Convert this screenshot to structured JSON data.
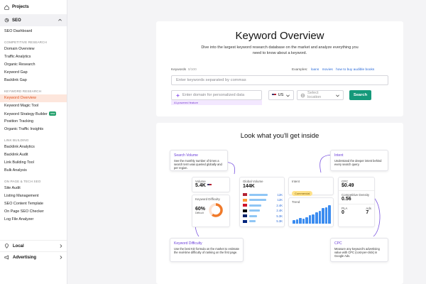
{
  "sidebar": {
    "projects": "Projects",
    "seo": "SEO",
    "seo_dashboard": "SEO Dashboard",
    "sections": [
      {
        "title": "COMPETITIVE RESEARCH",
        "items": [
          "Domain Overview",
          "Traffic Analytics",
          "Organic Research",
          "Keyword Gap",
          "Backlink Gap"
        ]
      },
      {
        "title": "KEYWORD RESEARCH",
        "items": [
          "Keyword Overview",
          "Keyword Magic Tool",
          "Keyword Strategy Builder",
          "Position Tracking",
          "Organic Traffic Insights"
        ]
      },
      {
        "title": "LINK BUILDING",
        "items": [
          "Backlink Analytics",
          "Backlink Audit",
          "Link Building Tool",
          "Bulk Analysis"
        ]
      },
      {
        "title": "ON PAGE & TECH SEO",
        "items": [
          "Site Audit",
          "Listing Management",
          "SEO Content Template",
          "On Page SEO Checker",
          "Log File Analyzer"
        ]
      }
    ],
    "new_badge": "new",
    "local": "Local",
    "advertising": "Advertising",
    "active_item": "Keyword Overview"
  },
  "hero": {
    "title": "Keyword Overview",
    "subtitle": "Dive into the largest keyword research database on the market and analyze everything you need to know about a keyword.",
    "keywords_label": "Keywords",
    "keywords_count": "0/100",
    "examples_label": "Examples:",
    "examples": [
      "loans",
      "movies",
      "how to buy audible books"
    ],
    "keyword_placeholder": "Enter keywords separated by commas",
    "domain_placeholder": "Enter domain for personalized data",
    "ai_label": "AI-powered feature",
    "country": "US",
    "location_placeholder": "Select location",
    "search_button": "Search"
  },
  "inside": {
    "title": "Look what you'll get inside",
    "callouts": {
      "search_volume": {
        "title": "Search Volume",
        "body": "See the monthly number of times a search term was queried globally and per region."
      },
      "intent": {
        "title": "Intent",
        "body": "Understand the deeper intent behind every search query."
      },
      "keyword_difficulty": {
        "title": "Keyword Difficulty",
        "body": "Use the best KD formula on the market to estimate the real-time difficulty of ranking on the first page."
      },
      "cpc": {
        "title": "CPC",
        "body": "Measure any keyword's advertising value with CPC (cost-per-click) in Google Ads."
      }
    },
    "mock": {
      "volume_label": "Volume",
      "volume_value": "5.4K",
      "kd_label": "Keyword Difficulty",
      "kd_value": "60%",
      "kd_sub": "Difficult",
      "global_label": "Global Volume",
      "global_value": "144K",
      "rows": [
        "12K",
        "12K",
        "2.4K",
        "2.4K",
        "5.3K",
        "5.3K"
      ],
      "bar_fractions": [
        0.85,
        0.8,
        0.55,
        0.5,
        0.35,
        0.3
      ],
      "intent_label": "Intent",
      "intent_value": "Commercial",
      "trend_label": "Trend",
      "trend_values": [
        0.2,
        0.25,
        0.3,
        0.28,
        0.35,
        0.45,
        0.5,
        0.6,
        0.7,
        0.85,
        0.9,
        1.0
      ],
      "cpc_label": "CPC",
      "cpc_value": "$0.49",
      "density_label": "Competitive Density",
      "density_value": "0.56",
      "pla_label": "PLA",
      "pla_value": "0",
      "ads_label": "Ads",
      "ads_value": "7"
    }
  },
  "colors": {
    "accent": "#15997a",
    "active": "#e0531f",
    "purple": "#6c3fd9"
  }
}
